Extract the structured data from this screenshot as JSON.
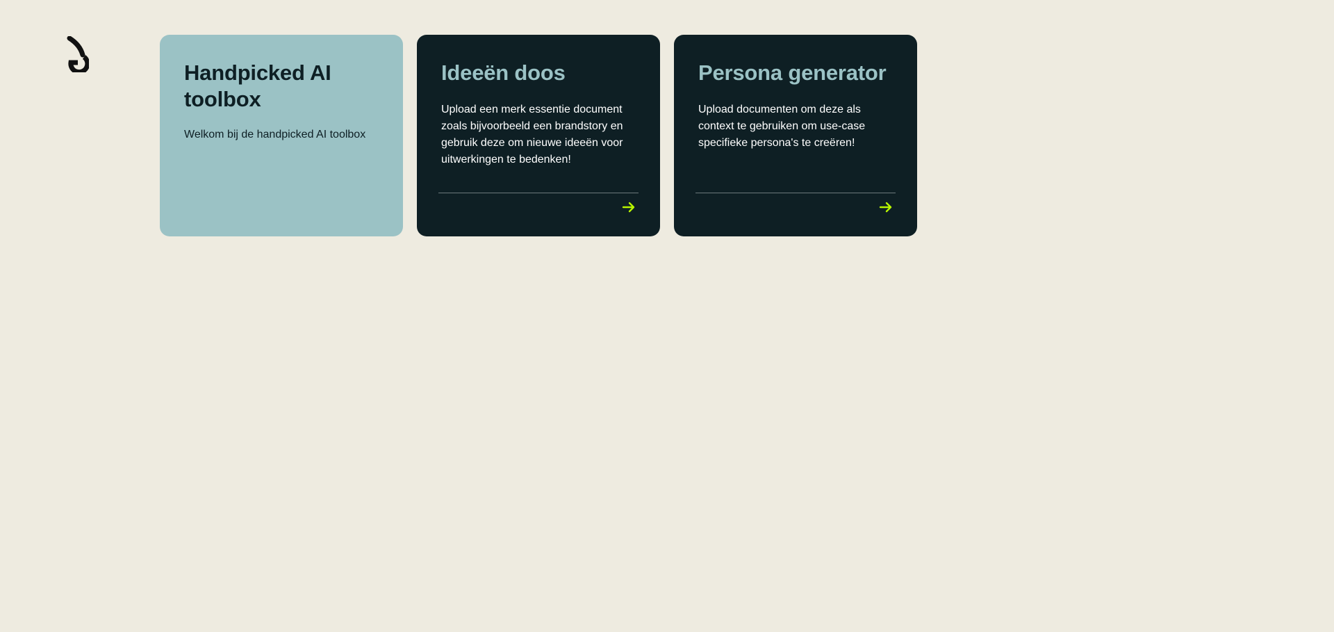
{
  "logo": {
    "icon": "brand-logo-icon"
  },
  "cards": {
    "intro": {
      "title": "Handpicked AI toolbox",
      "text": "Welkom bij de handpicked AI toolbox"
    },
    "ideas": {
      "title": "Ideeën doos",
      "text": "Upload een merk essentie document zoals bijvoorbeeld een brandstory en gebruik deze om nieuwe ideeën voor uitwerkingen te bedenken!",
      "arrow_icon": "arrow-right-icon"
    },
    "persona": {
      "title": "Persona generator",
      "text": "Upload documenten om deze als context te gebruiken om use-case specifieke persona's te creëren!",
      "arrow_icon": "arrow-right-icon"
    }
  },
  "colors": {
    "background": "#eeebe0",
    "intro_card": "#9bc2c5",
    "tool_card": "#0e1f24",
    "accent_arrow": "#b7f500"
  }
}
